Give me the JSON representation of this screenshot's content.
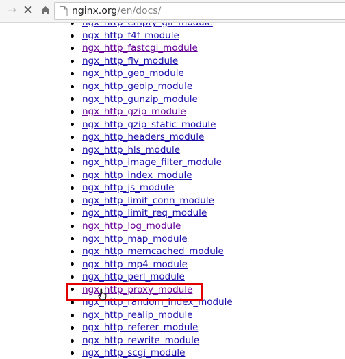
{
  "browser": {
    "icons": {
      "forward": "arrow-forward-icon",
      "stop": "close-icon",
      "home": "home-icon",
      "page": "page-icon"
    },
    "url_domain": "nginx.org",
    "url_path": "/en/docs/"
  },
  "modules": [
    {
      "label": "ngx_http_empty_gif_module",
      "visited": false
    },
    {
      "label": "ngx_http_f4f_module",
      "visited": false
    },
    {
      "label": "ngx_http_fastcgi_module",
      "visited": true
    },
    {
      "label": "ngx_http_flv_module",
      "visited": false
    },
    {
      "label": "ngx_http_geo_module",
      "visited": false
    },
    {
      "label": "ngx_http_geoip_module",
      "visited": false
    },
    {
      "label": "ngx_http_gunzip_module",
      "visited": false
    },
    {
      "label": "ngx_http_gzip_module",
      "visited": true
    },
    {
      "label": "ngx_http_gzip_static_module",
      "visited": false
    },
    {
      "label": "ngx_http_headers_module",
      "visited": false
    },
    {
      "label": "ngx_http_hls_module",
      "visited": false
    },
    {
      "label": "ngx_http_image_filter_module",
      "visited": false
    },
    {
      "label": "ngx_http_index_module",
      "visited": false
    },
    {
      "label": "ngx_http_js_module",
      "visited": false
    },
    {
      "label": "ngx_http_limit_conn_module",
      "visited": false
    },
    {
      "label": "ngx_http_limit_req_module",
      "visited": false
    },
    {
      "label": "ngx_http_log_module",
      "visited": true
    },
    {
      "label": "ngx_http_map_module",
      "visited": false
    },
    {
      "label": "ngx_http_memcached_module",
      "visited": false
    },
    {
      "label": "ngx_http_mp4_module",
      "visited": false
    },
    {
      "label": "ngx_http_perl_module",
      "visited": false
    },
    {
      "label": "ngx_http_proxy_module",
      "visited": true,
      "highlighted": true
    },
    {
      "label": "ngx_http_random_index_module",
      "visited": false
    },
    {
      "label": "ngx_http_realip_module",
      "visited": false
    },
    {
      "label": "ngx_http_referer_module",
      "visited": false
    },
    {
      "label": "ngx_http_rewrite_module",
      "visited": false
    },
    {
      "label": "ngx_http_scgi_module",
      "visited": false
    }
  ],
  "colors": {
    "link": "#1a0dab",
    "visited_link": "#660099",
    "highlight": "#e00000"
  }
}
